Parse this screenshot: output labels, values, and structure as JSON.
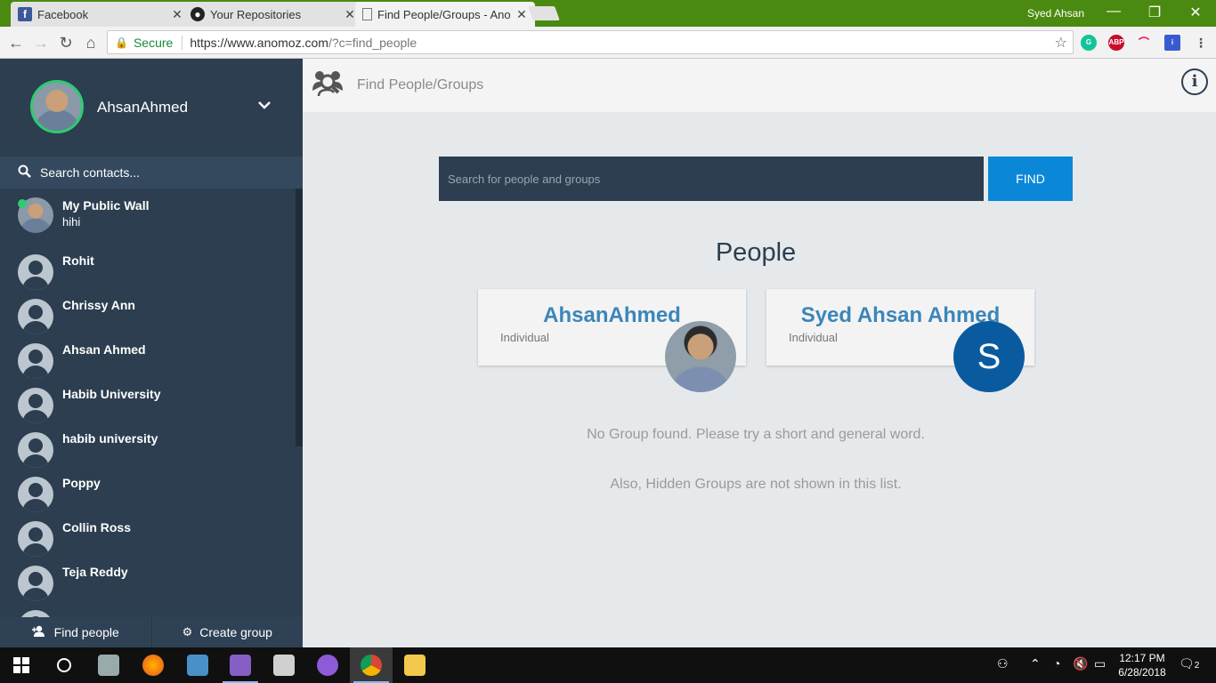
{
  "browser": {
    "tabs": [
      {
        "title": "Facebook",
        "icon": "facebook-icon"
      },
      {
        "title": "Your Repositories",
        "icon": "github-icon"
      },
      {
        "title": "Find People/Groups - Ano",
        "icon": "page-icon"
      }
    ],
    "window_user": "Syed Ahsan",
    "address": {
      "secure_label": "Secure",
      "url_host": "https://www.anomoz.com",
      "url_path": "/?c=find_people"
    }
  },
  "sidebar": {
    "profile_name": "AhsanAhmed",
    "search_placeholder": "Search contacts...",
    "contacts": [
      {
        "name": "My Public Wall",
        "sub": "hihi"
      },
      {
        "name": "Rohit"
      },
      {
        "name": "Chrissy Ann"
      },
      {
        "name": "Ahsan Ahmed"
      },
      {
        "name": "Habib University"
      },
      {
        "name": "habib university"
      },
      {
        "name": "Poppy"
      },
      {
        "name": "Collin Ross"
      },
      {
        "name": "Teja Reddy"
      }
    ],
    "find_people_label": "Find people",
    "create_group_label": "Create group"
  },
  "main": {
    "header_title": "Find People/Groups",
    "search_placeholder": "Search for people and groups",
    "find_label": "FIND",
    "people_heading": "People",
    "people": [
      {
        "name": "AhsanAhmed",
        "type": "Individual",
        "avatar": "photo"
      },
      {
        "name": "Syed Ahsan Ahmed",
        "type": "Individual",
        "avatar_letter": "S"
      }
    ],
    "no_group_msg": "No Group found. Please try a short and general word.",
    "hidden_groups_msg": "Also, Hidden Groups are not shown in this list."
  },
  "taskbar": {
    "time": "12:17 PM",
    "date": "6/28/2018",
    "notifications": "2"
  },
  "colors": {
    "sidebar_bg": "#2c3e50",
    "accent_blue": "#0b87d8",
    "name_blue": "#3b86b8",
    "online_green": "#2ecc71",
    "tabstrip_green": "#4a8a10"
  }
}
